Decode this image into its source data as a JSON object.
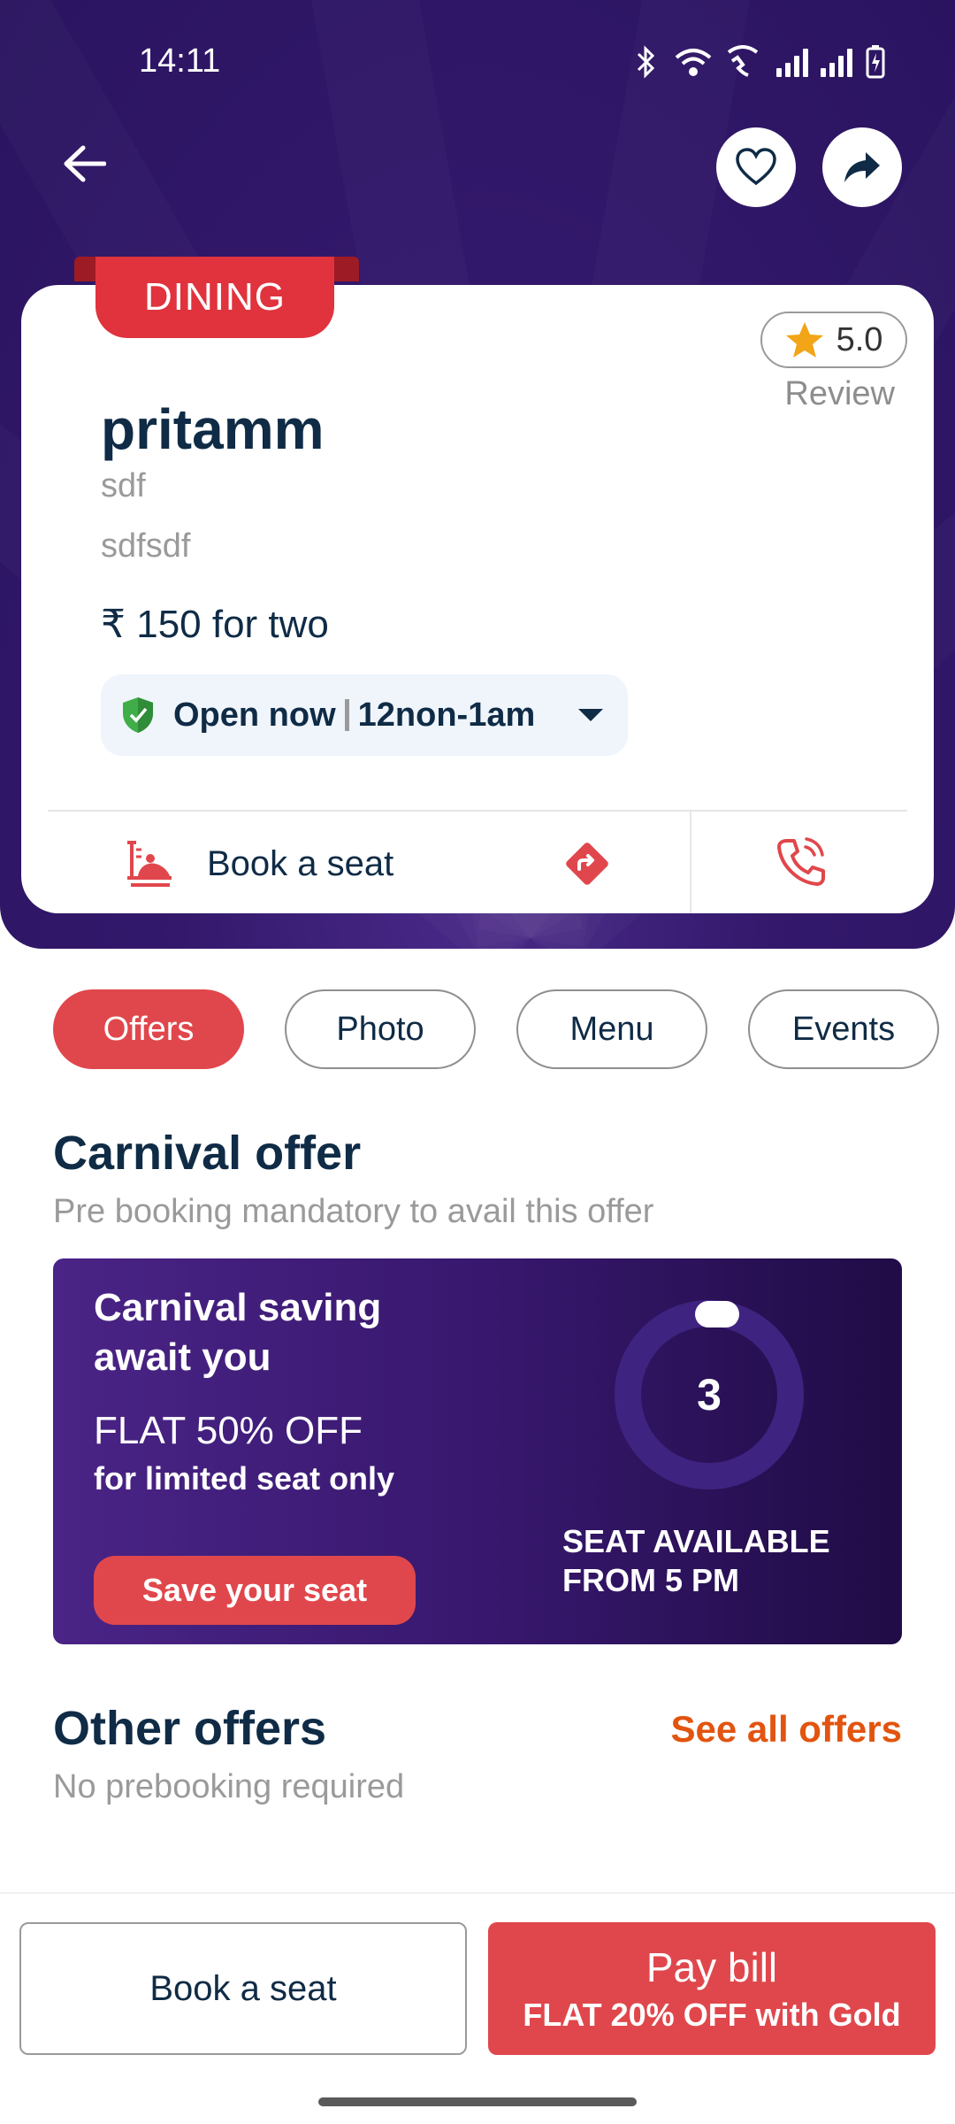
{
  "status_bar": {
    "time": "14:11"
  },
  "venue": {
    "category": "DINING",
    "rating": "5.0",
    "review_label": "Review",
    "name": "pritamm",
    "line1": "sdf",
    "line2": "sdfsdf",
    "price": "₹ 150 for two",
    "open_status": "Open now",
    "hours": "12non-1am"
  },
  "actions": {
    "book_seat": "Book a seat"
  },
  "tabs": [
    {
      "label": "Offers",
      "active": true
    },
    {
      "label": "Photo",
      "active": false
    },
    {
      "label": "Menu",
      "active": false
    },
    {
      "label": "Events",
      "active": false
    }
  ],
  "carnival": {
    "title": "Carnival offer",
    "subtitle": "Pre booking mandatory to avail this offer",
    "card": {
      "headline": "Carnival saving await you",
      "discount": "FLAT 50% OFF",
      "limit": "for limited seat only",
      "cta": "Save your seat",
      "seat_count": "3",
      "availability": "SEAT AVAILABLE FROM 5 PM"
    }
  },
  "other_offers": {
    "title": "Other offers",
    "subtitle": "No prebooking required",
    "see_all": "See all offers"
  },
  "bottom_bar": {
    "book_seat": "Book a seat",
    "pay_bill": "Pay bill",
    "pay_bill_offer": "FLAT 20% OFF with Gold"
  },
  "colors": {
    "hero_bg": "#2a1460",
    "accent_red": "#e0474c",
    "link_orange": "#e2540f",
    "text_navy": "#0f2b46",
    "star": "#f2a516",
    "shield_green": "#3fae49"
  },
  "icons": [
    "back-arrow-icon",
    "heart-icon",
    "share-icon",
    "star-icon",
    "shield-check-icon",
    "chevron-down-icon",
    "seat-icon",
    "directions-icon",
    "phone-icon"
  ]
}
